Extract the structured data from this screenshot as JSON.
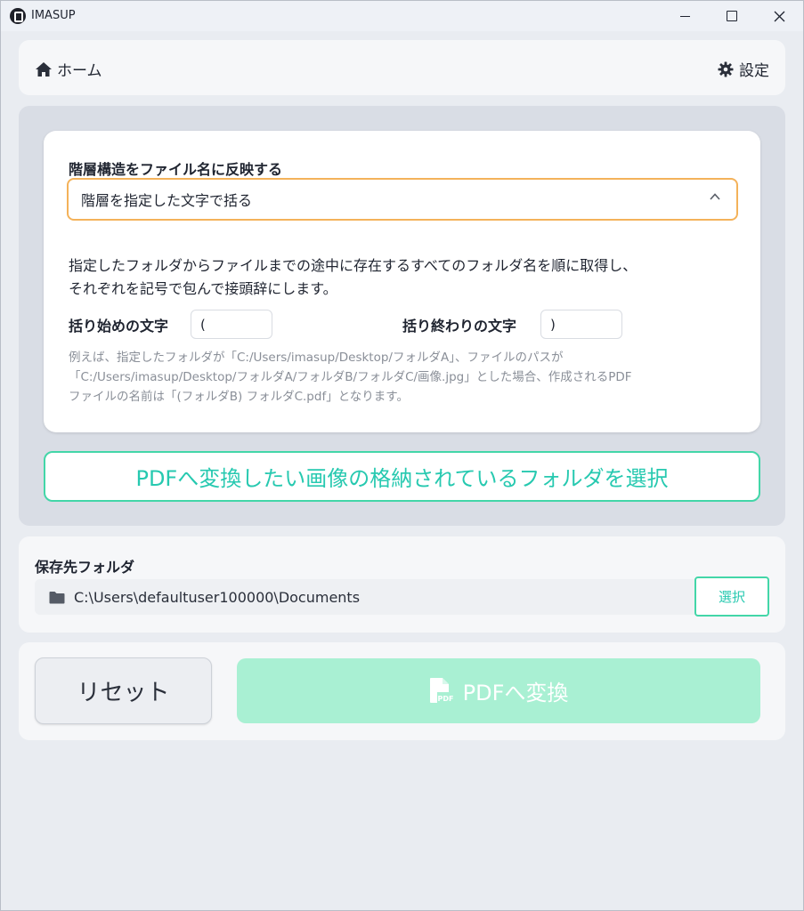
{
  "window": {
    "title": "IMASUP"
  },
  "nav": {
    "home_label": "ホーム",
    "settings_label": "設定"
  },
  "hierarchy": {
    "label": "階層構造をファイル名に反映する",
    "selected_option": "階層を指定した文字で括る",
    "description_line1": "指定したフォルダからファイルまでの途中に存在するすべてのフォルダ名を順に取得し、",
    "description_line2": "それぞれを記号で包んで接頭辞にします。",
    "start_char_label": "括り始めの文字",
    "start_char_value": "(",
    "end_char_label": "括り終わりの文字",
    "end_char_value": ")",
    "example_line1": "例えば、指定したフォルダが「C:/Users/imasup/Desktop/フォルダA」、ファイルのパスが",
    "example_line2": "「C:/Users/imasup/Desktop/フォルダA/フォルダB/フォルダC/画像.jpg」とした場合、作成されるPDF",
    "example_line3": "ファイルの名前は「(フォルダB) フォルダC.pdf」となります。"
  },
  "select_folder_button": "PDFへ変換したい画像の格納されているフォルダを選択",
  "save": {
    "label": "保存先フォルダ",
    "path": "C:\\Users\\defaultuser100000\\Documents",
    "choose_button": "選択"
  },
  "actions": {
    "reset_label": "リセット",
    "convert_label": "PDFへ変換",
    "convert_icon_text": "PDF"
  },
  "colors": {
    "accent": "#43d6a8",
    "accent_text": "#27c9b0",
    "select_border": "#f4b25a",
    "convert_disabled_bg": "#a9f0d3"
  },
  "icons": {
    "home": "home-icon",
    "settings": "gear-icon",
    "chevron": "chevron-up-icon",
    "folder": "folder-icon",
    "pdf": "pdf-file-icon"
  }
}
